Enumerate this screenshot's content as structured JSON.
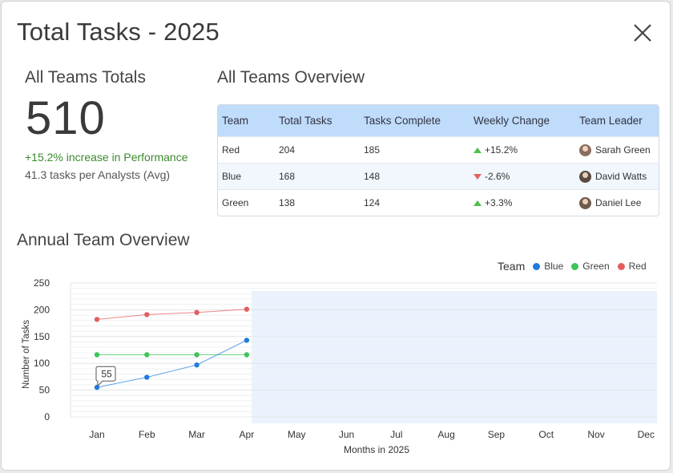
{
  "dialog": {
    "title": "Total Tasks - 2025",
    "close_icon": "close-icon"
  },
  "summary": {
    "heading": "All Teams Totals",
    "total": "510",
    "performance": "+15.2% increase in Performance",
    "average": "41.3 tasks per Analysts (Avg)"
  },
  "overview": {
    "heading": "All Teams Overview",
    "columns": [
      "Team",
      "Total Tasks",
      "Tasks Complete",
      "Weekly Change",
      "Team Leader"
    ],
    "rows": [
      {
        "team": "Red",
        "total": "204",
        "complete": "185",
        "change": "+15.2%",
        "direction": "up",
        "leader": "Sarah Green",
        "avatar_color": "#8a6e5d"
      },
      {
        "team": "Blue",
        "total": "168",
        "complete": "148",
        "change": "-2.6%",
        "direction": "down",
        "leader": "David Watts",
        "avatar_color": "#5b4a40"
      },
      {
        "team": "Green",
        "total": "138",
        "complete": "124",
        "change": "+3.3%",
        "direction": "up",
        "leader": "Daniel Lee",
        "avatar_color": "#6f5a4c"
      }
    ]
  },
  "annual": {
    "heading": "Annual Team Overview",
    "legend_title": "Team",
    "legend": [
      {
        "name": "Blue",
        "color": "#1f7be0"
      },
      {
        "name": "Green",
        "color": "#3fc35a"
      },
      {
        "name": "Red",
        "color": "#e35e5e"
      }
    ]
  },
  "chart_data": {
    "type": "line",
    "categories": [
      "Jan",
      "Feb",
      "Mar",
      "Apr",
      "May",
      "Jun",
      "Jul",
      "Aug",
      "Sep",
      "Oct",
      "Nov",
      "Dec"
    ],
    "series": [
      {
        "name": "Red",
        "color": "#e35e5e",
        "values": [
          182,
          191,
          195,
          201
        ]
      },
      {
        "name": "Green",
        "color": "#3fc35a",
        "values": [
          116,
          116,
          116,
          116
        ]
      },
      {
        "name": "Blue",
        "color": "#1f7be0",
        "values": [
          55,
          74,
          97,
          143
        ]
      }
    ],
    "xlabel": "Months in 2025",
    "ylabel": "Number of Tasks",
    "ylim": [
      0,
      250
    ],
    "yticks": [
      0,
      50,
      100,
      150,
      200,
      250
    ],
    "grid": true,
    "future_shaded_from": "May",
    "tooltip": {
      "series": "Blue",
      "category": "Jan",
      "text": "55"
    }
  }
}
